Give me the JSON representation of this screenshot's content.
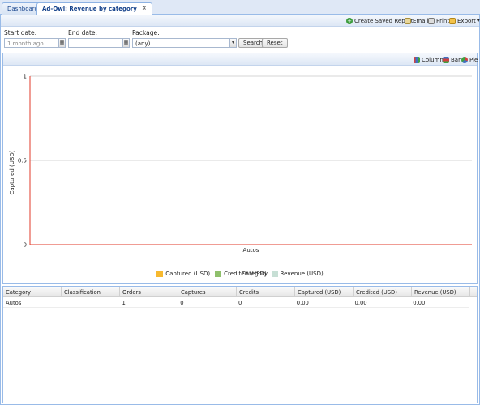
{
  "tabs": [
    {
      "label": "Dashboard",
      "active": false
    },
    {
      "label": "Ad-Owl: Revenue by category",
      "active": true
    }
  ],
  "top_toolbar": {
    "create_saved_report": "Create Saved Report",
    "email": "Email",
    "print": "Print",
    "export": "Export"
  },
  "filters": {
    "start_date_label": "Start date:",
    "start_date_value": "1 month ago",
    "end_date_label": "End date:",
    "end_date_value": "",
    "package_label": "Package:",
    "package_value": "(any)",
    "search_label": "Search",
    "reset_label": "Reset"
  },
  "chart_toolbar": {
    "column": "Column",
    "bar": "Bar",
    "pie": "Pie"
  },
  "chart_data": {
    "type": "bar",
    "categories": [
      "Autos"
    ],
    "series": [
      {
        "name": "Captured (USD)",
        "values": [
          0
        ],
        "color": "#f7b92f"
      },
      {
        "name": "Credited (USD)",
        "values": [
          0
        ],
        "color": "#8fc06c"
      },
      {
        "name": "Revenue (USD)",
        "values": [
          0
        ],
        "color": "#c7dfd5"
      }
    ],
    "title": "",
    "xlabel": "Category",
    "ylabel": "Captured (USD)",
    "ylim": [
      0,
      1
    ],
    "yticks": [
      "0",
      "0.5",
      "1"
    ],
    "grid": true,
    "legend": "bottom",
    "axis_color": "#e03a2a"
  },
  "grid": {
    "columns": [
      "Category",
      "Classification",
      "Orders",
      "Captures",
      "Credits",
      "Captured (USD)",
      "Credited (USD)",
      "Revenue (USD)"
    ],
    "rows": [
      [
        "Autos",
        "",
        "1",
        "0",
        "0",
        "0.00",
        "0.00",
        "0.00"
      ]
    ]
  }
}
